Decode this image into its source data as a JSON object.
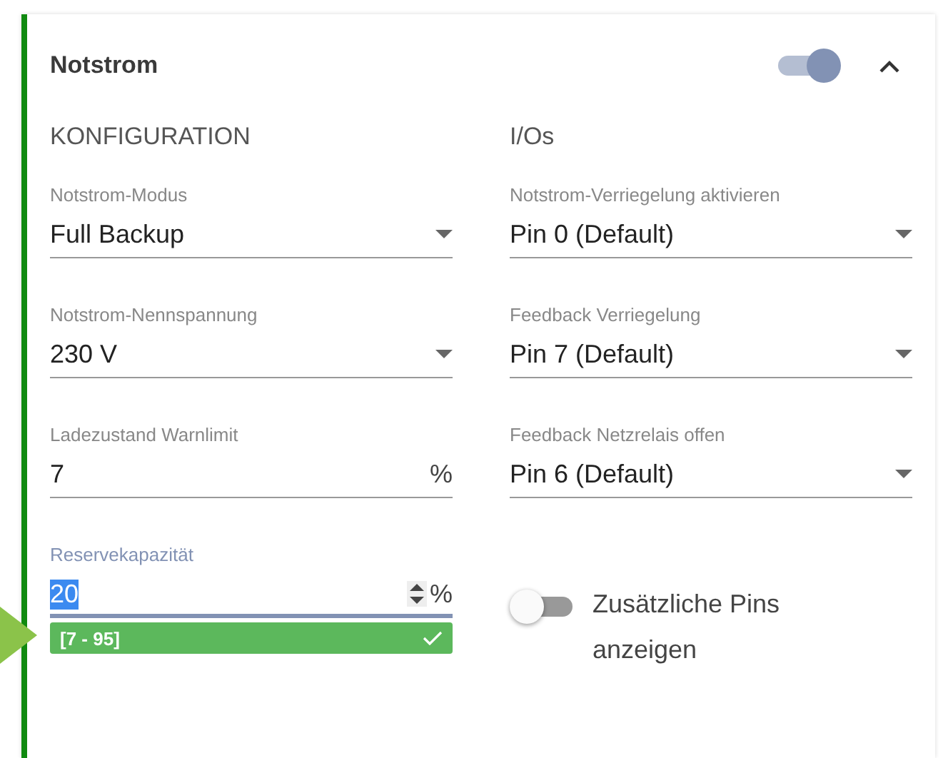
{
  "panel": {
    "title": "Notstrom",
    "enabled": true,
    "expanded": true
  },
  "configuration": {
    "heading": "KONFIGURATION",
    "fields": [
      {
        "kind": "select",
        "label": "Notstrom-Modus",
        "value": "Full Backup"
      },
      {
        "kind": "select",
        "label": "Notstrom-Nennspannung",
        "value": "230 V"
      },
      {
        "kind": "number",
        "label": "Ladezustand Warnlimit",
        "value": "7",
        "unit": "%",
        "focused": false
      },
      {
        "kind": "number",
        "label": "Reservekapazität",
        "value": "20",
        "unit": "%",
        "focused": true,
        "hint": "[7 - 95]",
        "valid": true
      }
    ]
  },
  "ios": {
    "heading": "I/Os",
    "fields": [
      {
        "kind": "select",
        "label": "Notstrom-Verriegelung aktivieren",
        "value": "Pin 0 (Default)"
      },
      {
        "kind": "select",
        "label": "Feedback Verriegelung",
        "value": "Pin 7 (Default)"
      },
      {
        "kind": "select",
        "label": "Feedback Netzrelais offen",
        "value": "Pin 6 (Default)"
      },
      {
        "kind": "switch",
        "label": "Zusätzliche Pins anzeigen",
        "on": false
      }
    ]
  }
}
